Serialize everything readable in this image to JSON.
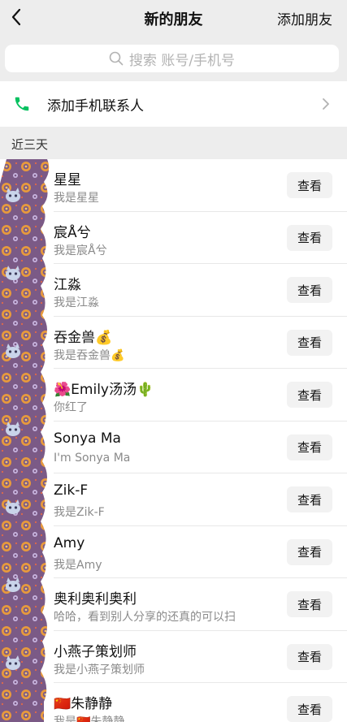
{
  "header": {
    "back_icon": "chevron-left-icon",
    "title": "新的朋友",
    "action_label": "添加朋友"
  },
  "search": {
    "icon": "search-icon",
    "placeholder": "搜索 账号/手机号"
  },
  "add_phone": {
    "icon": "phone-icon",
    "label": "添加手机联系人",
    "arrow_icon": "chevron-right-icon"
  },
  "section": {
    "label": "近三天"
  },
  "friends": [
    {
      "name": "星星",
      "sub": "我是星星",
      "button": "查看"
    },
    {
      "name": "宸Å兮",
      "sub": "我是宸Å兮",
      "button": "查看"
    },
    {
      "name": "江淼",
      "sub": "我是江淼",
      "button": "查看"
    },
    {
      "name": "吞金兽💰",
      "sub": "我是吞金兽💰",
      "button": "查看"
    },
    {
      "name": "🌺Emily汤汤🌵",
      "sub": "你红了",
      "button": "查看"
    },
    {
      "name": "Sonya Ma",
      "sub": "I'm Sonya Ma",
      "button": "查看"
    },
    {
      "name": "Zik-F",
      "sub": "我是Zik-F",
      "button": "查看"
    },
    {
      "name": "Amy",
      "sub": "我是Amy",
      "button": "查看"
    },
    {
      "name": "奥利奥利奥利",
      "sub": "哈哈，看到别人分享的还真的可以扫",
      "button": "查看"
    },
    {
      "name": "小燕子策划师",
      "sub": "我是小燕子策划师",
      "button": "查看"
    },
    {
      "name": "🇨🇳朱静静",
      "sub": "我是🇨🇳朱静静",
      "button": "查看"
    }
  ],
  "colors": {
    "accent_green": "#07c160",
    "background": "#ededed",
    "avatar_mask": "#7b5a86"
  }
}
